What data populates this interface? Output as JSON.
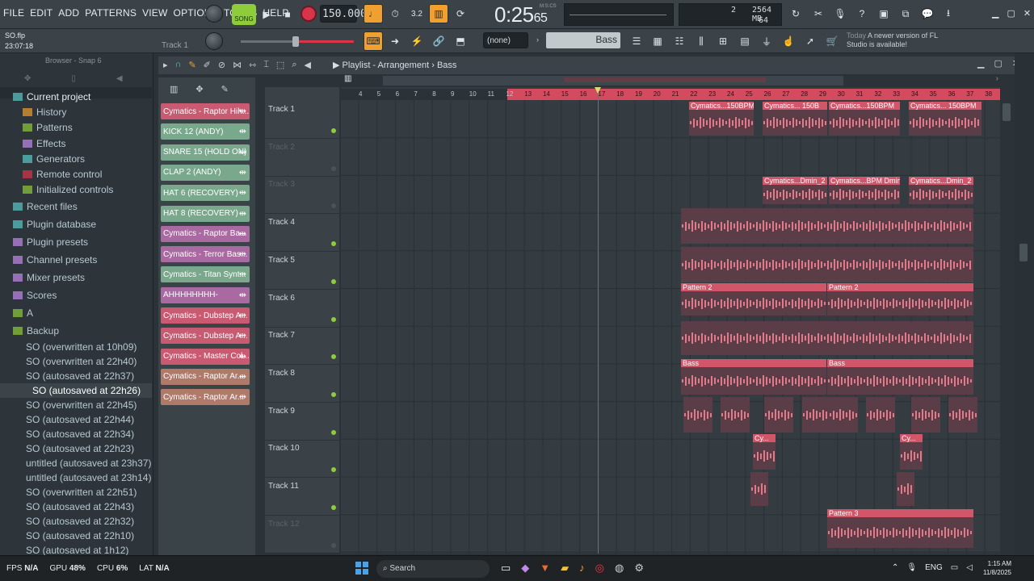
{
  "menu": [
    "FILE",
    "EDIT",
    "ADD",
    "PATTERNS",
    "VIEW",
    "OPTIONS",
    "TOOLS",
    "HELP"
  ],
  "transport": {
    "song_label": "SONG",
    "tempo": "150.000",
    "time_main": "0:25",
    "time_sub": "65",
    "time_unit": "M:S:CS",
    "memory": "2564 MB",
    "voices": "64",
    "track_num": "2"
  },
  "project": {
    "file": "SO.flp",
    "time": "23:07:18",
    "track_label": "Track 1"
  },
  "toolbar2": {
    "pattern_none": "(none)",
    "bass_label": "Bass"
  },
  "news": {
    "today": "Today",
    "message": "A newer version of FL Studio is available!"
  },
  "browser": {
    "title": "Browser - Snap 6",
    "items": [
      {
        "label": "Current project",
        "indent": 0
      },
      {
        "label": "History",
        "indent": 1
      },
      {
        "label": "Patterns",
        "indent": 1
      },
      {
        "label": "Effects",
        "indent": 1
      },
      {
        "label": "Generators",
        "indent": 1
      },
      {
        "label": "Remote control",
        "indent": 1
      },
      {
        "label": "Initialized controls",
        "indent": 1
      },
      {
        "label": "Recent files",
        "indent": 0
      },
      {
        "label": "Plugin database",
        "indent": 0
      },
      {
        "label": "Plugin presets",
        "indent": 0
      },
      {
        "label": "Channel presets",
        "indent": 0
      },
      {
        "label": "Mixer presets",
        "indent": 0
      },
      {
        "label": "Scores",
        "indent": 0
      },
      {
        "label": "A",
        "indent": 0
      },
      {
        "label": "Backup",
        "indent": 0
      }
    ],
    "backups": [
      "SO (overwritten at 10h09)",
      "SO (overwritten at 22h40)",
      "SO (autosaved at 22h37)",
      "SO (autosaved at 22h26)",
      "SO (overwritten at 22h45)",
      "SO (autosaved at 22h44)",
      "SO (autosaved at 22h34)",
      "SO (autosaved at 22h23)",
      "untitled (autosaved at 23h37)",
      "untitled (autosaved at 23h14)",
      "SO (overwritten at 22h51)",
      "SO (autosaved at 22h43)",
      "SO (autosaved at 22h32)",
      "SO (autosaved at 22h10)",
      "SO (autosaved at 1h12)"
    ]
  },
  "channels": [
    {
      "name": "Cymatics - Raptor Hih...",
      "color": "#c85a72"
    },
    {
      "name": "KICK 12 (ANDY)",
      "color": "#7aa88c"
    },
    {
      "name": "SNARE 15 (HOLD ON)",
      "color": "#7aa88c"
    },
    {
      "name": "CLAP 2 (ANDY)",
      "color": "#7aa88c"
    },
    {
      "name": "HAT 6 (RECOVERY)",
      "color": "#7aa88c"
    },
    {
      "name": "HAT 8 (RECOVERY)",
      "color": "#7aa88c"
    },
    {
      "name": "Cymatics - Raptor Ba...",
      "color": "#a86aa0"
    },
    {
      "name": "Cymatics - Terror Bas...",
      "color": "#a86aa0"
    },
    {
      "name": "Cymatics - Titan Synt...",
      "color": "#7aa88c"
    },
    {
      "name": "AHHHHHHHH-",
      "color": "#a86aa0"
    },
    {
      "name": "Cymatics - Dubstep A...",
      "color": "#c85a72"
    },
    {
      "name": "Cymatics - Dubstep A...",
      "color": "#c85a72"
    },
    {
      "name": "Cymatics - Master Col...",
      "color": "#c85a72"
    },
    {
      "name": "Cymatics - Raptor Ar...",
      "color": "#b07a6a"
    },
    {
      "name": "Cymatics - Raptor Ar...",
      "color": "#b07a6a"
    }
  ],
  "playlist": {
    "title": "Playlist - Arrangement",
    "pattern": "Bass",
    "bars": [
      "4",
      "5",
      "6",
      "7",
      "8",
      "9",
      "10",
      "11",
      "12",
      "13",
      "14",
      "15",
      "16",
      "17",
      "18",
      "19",
      "20",
      "21",
      "22",
      "23",
      "24",
      "25",
      "26",
      "27",
      "28",
      "29",
      "30",
      "31",
      "32",
      "33",
      "34",
      "35",
      "36",
      "37",
      "38"
    ],
    "tracks": [
      {
        "label": "Track 1",
        "dim": false
      },
      {
        "label": "Track 2",
        "dim": true
      },
      {
        "label": "Track 3",
        "dim": true
      },
      {
        "label": "Track 4",
        "dim": false
      },
      {
        "label": "Track 5",
        "dim": false
      },
      {
        "label": "Track 6",
        "dim": false
      },
      {
        "label": "Track 7",
        "dim": false
      },
      {
        "label": "Track 8",
        "dim": false
      },
      {
        "label": "Track 9",
        "dim": false
      },
      {
        "label": "Track 10",
        "dim": false
      },
      {
        "label": "Track 11",
        "dim": false
      },
      {
        "label": "Track 12",
        "dim": true
      }
    ],
    "clips": {
      "t1": [
        "Cymatics...150BPM",
        "Cymatics... 150B",
        "Cymatics...150BPM",
        "Cymatics... 150BPM"
      ],
      "t3": [
        "Cymatics...Dmin_2",
        "Cymatics...BPM Dmin",
        "Cymatics...Dmin_2"
      ],
      "t6": [
        "Pattern 2",
        "Pattern 2"
      ],
      "t8": [
        "Bass",
        "Bass"
      ],
      "t10": [
        "Cy...",
        "Cy..."
      ],
      "t12": [
        "Pattern 3"
      ]
    }
  },
  "status": {
    "fps_label": "FPS",
    "fps": "N/A",
    "gpu_label": "GPU",
    "gpu": "48%",
    "cpu_label": "CPU",
    "cpu": "6%",
    "lat_label": "LAT",
    "lat": "N/A",
    "search": "Search",
    "lang": "ENG",
    "clock": "1:15 AM",
    "date": "11/8/2025"
  }
}
